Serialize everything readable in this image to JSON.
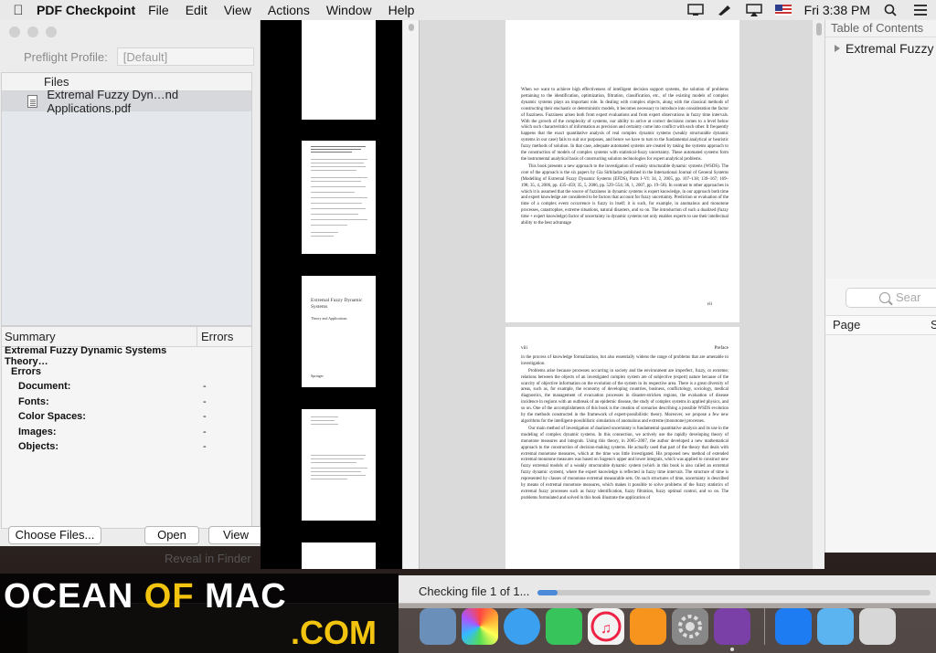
{
  "menubar": {
    "app_name": "PDF Checkpoint",
    "items": [
      "File",
      "Edit",
      "View",
      "Actions",
      "Window",
      "Help"
    ],
    "clock": "Fri 3:38 PM"
  },
  "preflight": {
    "profile_label": "Preflight Profile:",
    "profile_value": "[Default]",
    "files_header": "Files",
    "file_name": "Extremal Fuzzy Dyn…nd Applications.pdf",
    "summary_header": "Summary",
    "errors_header": "Errors",
    "summary_rows": [
      {
        "label": "Extremal Fuzzy Dynamic Systems Theory…",
        "value": ""
      },
      {
        "label": "Errors",
        "value": ""
      },
      {
        "label": "Document:",
        "value": "-"
      },
      {
        "label": "Fonts:",
        "value": "-"
      },
      {
        "label": "Color Spaces:",
        "value": "-"
      },
      {
        "label": "Images:",
        "value": "-"
      },
      {
        "label": "Objects:",
        "value": "-"
      }
    ],
    "choose_files_label": "Choose Files...",
    "open_label": "Open",
    "view_label": "View",
    "reveal_label": "Reveal in Finder"
  },
  "viewer": {
    "thumb_title_1": "Extremal Fuzzy Dynamic Systems",
    "thumb_subtitle_1": "Theory and Applications",
    "thumb_publisher": "Springer",
    "page1_paragraphs": [
      "When we want to achieve high effectiveness of intelligent decision support systems, the solution of problems pertaining to the identification, optimization, filtration, classification, etc., of the existing models of complex dynamic systems plays an important role. In dealing with complex objects, along with the classical methods of constructing their stochastic or deterministic models, it becomes necessary to introduce into consideration the factor of fuzziness. Fuzziness arises both from expert evaluations and from expert observations in fuzzy time intervals. With the growth of the complexity of systems, our ability to arrive at correct decisions comes to a level below which such characteristics of information as precision and certainty come into conflict with each other. It frequently happens that the exact quantitative analysis of real complex dynamic systems (weakly structurable dynamic systems in our case) fails to suit our purposes, and hence we have to turn to the fundamental analytical or heuristic fuzzy methods of solution. In that case, adequate automated systems are created by taking the systems approach to the construction of models of complex systems with statistical-fuzzy uncertainty. These automated systems form the instrumental analytical basis of constructing solution technologies for expert analytical problems.",
      "This book presents a new approach to the investigation of weakly structurable dynamic systems (WSDS). The core of the approach is the six papers by Gia Sirbiladze published in the International Journal of General Systems (Modelling of Extremal Fuzzy Dynamic Systems (EFDS), Parts I–VI: 34, 2, 2005, pp. 107–138; 139–167; 169–198; 35, 4, 2006, pp. 435–459; 35, 5, 2006, pp. 529–554; 36, 1, 2007, pp. 19–58). In contrast to other approaches in which it is assumed that the source of fuzziness in dynamic systems is expert knowledge, in our approach both time and expert knowledge are considered to be factors that account for fuzzy uncertainty. Prediction or evaluation of the time of a complex event occurrence is fuzzy in itself; it is such, for example, in anomalous and monotone processes, catastrophes, extreme situations, natural disasters, and so on. The introduction of such a dualized (fuzzy time + expert knowledge) factor of uncertainty in dynamic systems not only enables experts to use their intellectual ability to the best advantage"
    ],
    "page1_number": "vii",
    "page2_header_left": "viii",
    "page2_header_right": "Preface",
    "page2_paragraphs": [
      "in the process of knowledge formalization, but also essentially widens the range of problems that are amenable to investigation.",
      "Problems arise because processes occurring in society and the environment are imperfect, fuzzy, or extreme; relations between the objects of an investigated complex system are of subjective (expert) nature because of the scarcity of objective information on the evolution of the system in its respective area. There is a great diversity of areas, such as, for example, the economy of developing countries, business, conflictology, sociology, medical diagnostics, the management of evacuation processes in disaster-stricken regions, the evaluation of disease incidence in regions with an outbreak of an epidemic disease, the study of complex systems in applied physics, and so on. One of the accomplishments of this book is the creation of scenarios describing a possible WSDS evolution by the methods constructed in the framework of expert-possibilistic theory. Moreover, we propose a few new algorithms for the intelligent-possibilistic simulation of anomalous and extreme (monotone) processes.",
      "Our main method of investigation of dualized uncertainty is fundamental quantitative analysis and its use in the modeling of complex dynamic systems. In this connection, we actively use the rapidly developing theory of monotone measures and integrals. Using this theory, in 2005–2007, the author developed a new mathematical approach to the construction of decision-making systems. He actually used that part of the theory that deals with extremal monotone measures, which at the time was little investigated. His proposed new method of extended extremal monotone measures was based on Sugeno's upper and lower integrals, which was applied to construct new fuzzy extremal models of a weakly structurable dynamic system (which in this book is also called an extremal fuzzy dynamic system), where the expert knowledge is reflected in fuzzy time intervals. The structure of time is represented by classes of monotone extremal measurable sets. On such structures of time, uncertainty is described by means of extremal monotone measures, which makes it possible to solve problems of the fuzzy statistics of extremal fuzzy processes such as fuzzy identification, fuzzy filtration, fuzzy optimal control, and so on. The problems formulated and solved in this book illustrate the application of"
    ]
  },
  "toc": {
    "header": "Table of Contents",
    "item": "Extremal Fuzzy D",
    "search_placeholder": "Sear",
    "page_col": "Page",
    "second_col": "S"
  },
  "status": {
    "text": "Checking file 1 of 1...",
    "progress": 0.05
  },
  "watermark": {
    "ocean": "OCEAN",
    "of": "OF",
    "mac": "MAC",
    "com": ".COM"
  },
  "colors": {
    "accent_yellow": "#f2c40f",
    "menubar": "#e9e9ea"
  }
}
